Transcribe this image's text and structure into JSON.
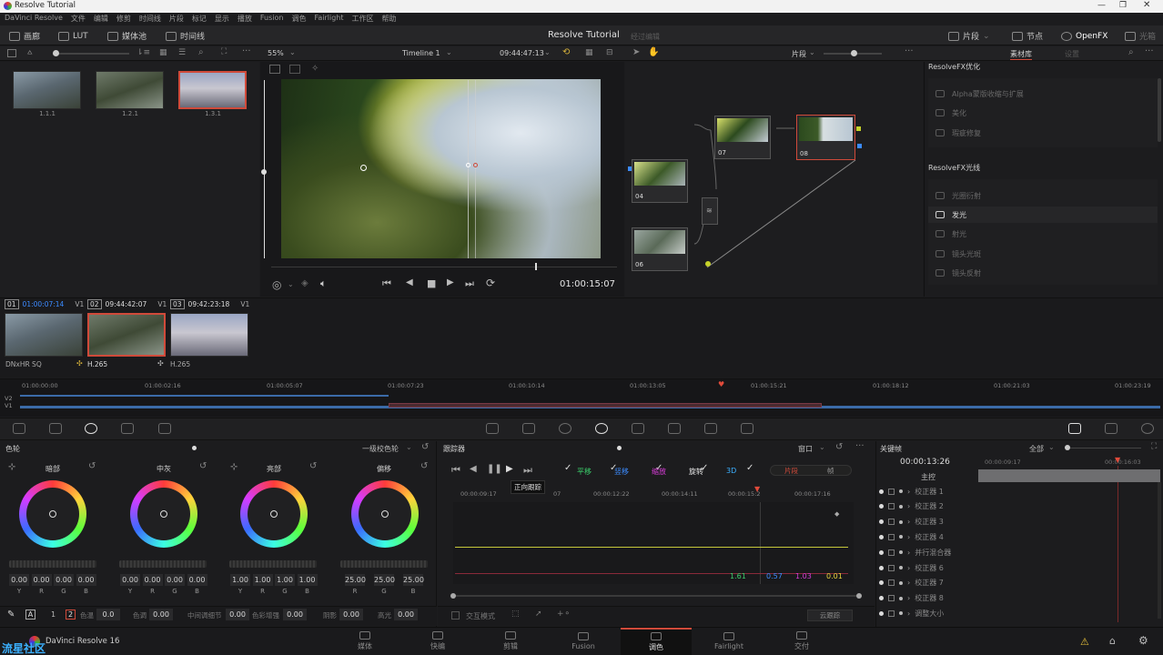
{
  "window": {
    "title": "Resolve Tutorial"
  },
  "menu": [
    "DaVinci Resolve",
    "文件",
    "编辑",
    "修剪",
    "时间线",
    "片段",
    "标记",
    "显示",
    "播放",
    "Fusion",
    "调色",
    "Fairlight",
    "工作区",
    "帮助"
  ],
  "toolbar": {
    "left": [
      "画廊",
      "LUT",
      "媒体池",
      "时间线"
    ],
    "project_title": "Resolve Tutorial",
    "project_status": "经过编辑",
    "right": [
      "片段",
      "节点",
      "OpenFX",
      "光箱"
    ]
  },
  "viewer": {
    "zoom": "55%",
    "timeline_name": "Timeline 1",
    "timecode": "09:44:47:13",
    "clip_mode": "片段",
    "playhead_tc": "01:00:15:07"
  },
  "gallery": {
    "stills": [
      "1.1.1",
      "1.2.1",
      "1.3.1"
    ]
  },
  "clips": [
    {
      "num": "01",
      "tc": "01:00:07:14",
      "track": "V1",
      "codec": "DNxHR SQ"
    },
    {
      "num": "02",
      "tc": "09:44:42:07",
      "track": "V1",
      "codec": "H.265"
    },
    {
      "num": "03",
      "tc": "09:42:23:18",
      "track": "V1",
      "codec": "H.265"
    }
  ],
  "nodes": [
    {
      "id": "04"
    },
    {
      "id": "06"
    },
    {
      "id": "07"
    },
    {
      "id": "08"
    }
  ],
  "library": {
    "tabs": [
      "素材库",
      "设置"
    ],
    "sections": [
      {
        "title": "ResolveFX优化",
        "items": [
          "Alpha蒙版收缩与扩展",
          "美化",
          "瑕疵修复"
        ]
      },
      {
        "title": "ResolveFX光线",
        "items": [
          "光圈衍射",
          "发光",
          "射光",
          "镜头光斑",
          "镜头反射"
        ]
      }
    ],
    "highlighted": "发光"
  },
  "timeline_ruler": [
    "01:00:00:00",
    "01:00:02:16",
    "01:00:05:07",
    "01:00:07:23",
    "01:00:10:14",
    "01:00:13:05",
    "01:00:15:21",
    "01:00:18:12",
    "01:00:21:03",
    "01:00:23:19"
  ],
  "tracks": [
    "V2",
    "V1"
  ],
  "color_wheels": {
    "panel_title": "色轮",
    "mode": "一级校色轮",
    "wheels": [
      {
        "name": "暗部",
        "values": [
          "0.00",
          "0.00",
          "0.00",
          "0.00"
        ],
        "labels": [
          "Y",
          "R",
          "G",
          "B"
        ]
      },
      {
        "name": "中灰",
        "values": [
          "0.00",
          "0.00",
          "0.00",
          "0.00"
        ],
        "labels": [
          "Y",
          "R",
          "G",
          "B"
        ]
      },
      {
        "name": "亮部",
        "values": [
          "1.00",
          "1.00",
          "1.00",
          "1.00"
        ],
        "labels": [
          "Y",
          "R",
          "G",
          "B"
        ]
      },
      {
        "name": "偏移",
        "values": [
          "25.00",
          "25.00",
          "25.00"
        ],
        "labels": [
          "R",
          "G",
          "B"
        ]
      }
    ],
    "bottom": {
      "page1": "1",
      "page2": "2",
      "items": [
        {
          "label": "色温",
          "value": "0.0"
        },
        {
          "label": "色调",
          "value": "0.00"
        },
        {
          "label": "中间调细节",
          "value": "0.00"
        },
        {
          "label": "色彩增强",
          "value": "0.00"
        },
        {
          "label": "阴影",
          "value": "0.00"
        },
        {
          "label": "高光",
          "value": "0.00"
        }
      ]
    }
  },
  "tracker": {
    "panel_title": "跟踪器",
    "mode": "窗口",
    "tooltip": "正向跟踪",
    "checks": [
      {
        "label": "平移",
        "color": "#3bd06b"
      },
      {
        "label": "竖移",
        "color": "#3b8bff"
      },
      {
        "label": "缩放",
        "color": "#d63bd6"
      },
      {
        "label": "旋转",
        "color": "#e8e8e8"
      },
      {
        "label": "3D",
        "color": "#3bb0ff"
      }
    ],
    "view_tabs": [
      "片段",
      "帧"
    ],
    "ruler": [
      "00:00:09:17",
      "07",
      "00:00:12:22",
      "00:00:14:11",
      "00:00:15:2",
      "00:00:17:16"
    ],
    "values": [
      {
        "v": "1.61",
        "color": "#3bd06b"
      },
      {
        "v": "0.57",
        "color": "#3b8bff"
      },
      {
        "v": "1.03",
        "color": "#d63bd6"
      },
      {
        "v": "0.01",
        "color": "#e8d23b"
      }
    ],
    "footer": {
      "interactive": "交互模式",
      "mode_btn": "云跟踪"
    }
  },
  "keyframes": {
    "panel_title": "关键帧",
    "filter": "全部",
    "timecode": "00:00:13:26",
    "ruler": [
      "00:00:09:17",
      "00:00:16:03"
    ],
    "master": "主控",
    "rows": [
      "校正器 1",
      "校正器 2",
      "校正器 3",
      "校正器 4",
      "并行混合器",
      "校正器 6",
      "校正器 7",
      "校正器 8",
      "调整大小"
    ]
  },
  "pages": [
    {
      "label": "媒体",
      "icon": "media-icon"
    },
    {
      "label": "快编",
      "icon": "cut-icon"
    },
    {
      "label": "剪辑",
      "icon": "edit-icon"
    },
    {
      "label": "Fusion",
      "icon": "fusion-icon"
    },
    {
      "label": "调色",
      "icon": "color-icon"
    },
    {
      "label": "Fairlight",
      "icon": "fairlight-icon"
    },
    {
      "label": "交付",
      "icon": "deliver-icon"
    }
  ],
  "app_brand": "DaVinci Resolve 16",
  "watermark": "流星社区",
  "colors": {
    "accent": "#d04a3a",
    "timecode_blue": "#3b8bff"
  }
}
